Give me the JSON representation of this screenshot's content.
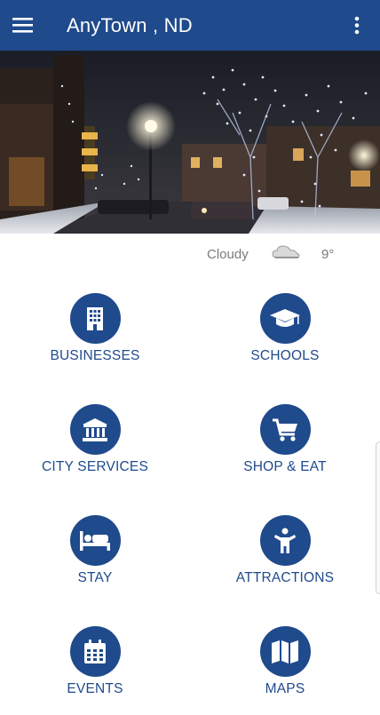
{
  "appbar": {
    "title": "AnyTown , ND"
  },
  "weather": {
    "condition": "Cloudy",
    "temperature": "9°",
    "icon": "cloud-icon"
  },
  "tiles": [
    {
      "label": "BUSINESSES",
      "icon": "building-icon"
    },
    {
      "label": "SCHOOLS",
      "icon": "graduation-cap-icon"
    },
    {
      "label": "CITY SERVICES",
      "icon": "government-building-icon"
    },
    {
      "label": "SHOP & EAT",
      "icon": "shopping-cart-icon"
    },
    {
      "label": "STAY",
      "icon": "bed-icon"
    },
    {
      "label": "ATTRACTIONS",
      "icon": "person-icon"
    },
    {
      "label": "EVENTS",
      "icon": "calendar-icon"
    },
    {
      "label": "MAPS",
      "icon": "map-icon"
    }
  ],
  "colors": {
    "primary": "#1f4a8c",
    "muted_text": "#7a7a7a"
  }
}
